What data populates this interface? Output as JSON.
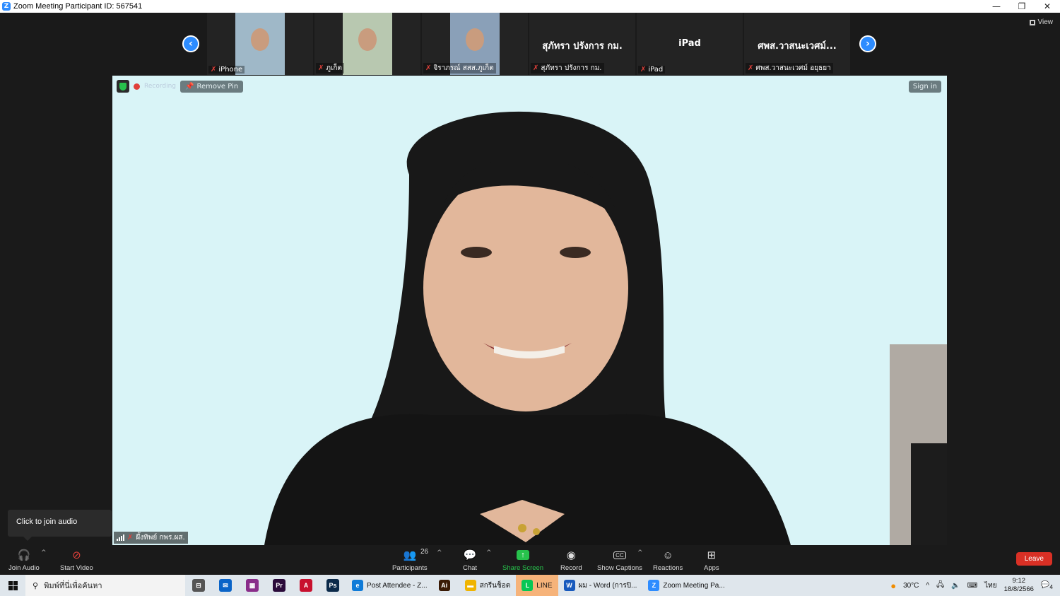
{
  "window": {
    "title": "Zoom Meeting Participant ID: 567541",
    "logo_letter": "Z",
    "minimize": "—",
    "restore": "❐",
    "close": "✕"
  },
  "view_button": "View",
  "strip": {
    "prev": "‹",
    "next": "›",
    "tiles": [
      {
        "name": "iPhone",
        "has_video": true,
        "video_color": "#9fb8c8"
      },
      {
        "name": "ภูเก็ต",
        "has_video": true,
        "video_color": "#b8c8b0"
      },
      {
        "name": "จิราภรณ์ สสส.ภูเก็ต",
        "has_video": true,
        "video_color": "#8aa0b8"
      },
      {
        "name": "สุภัทรา ปรังการ กม.",
        "big_name": "สุภัทรา ปรังการ กม.",
        "has_video": false
      },
      {
        "name": "iPad",
        "big_name": "iPad",
        "has_video": false
      },
      {
        "name": "ศพส.วาสนะเวศม์ อยุธยา",
        "big_name": "ศพส.วาสนะเวศม์...",
        "has_video": false
      }
    ]
  },
  "main_video": {
    "recording_label": "Recording",
    "remove_pin": "Remove Pin",
    "sign_in": "Sign in",
    "participant_name": "ผึ้งทิพย์ กพร.ผส.",
    "bg_color": "#d8f3f7"
  },
  "tooltip": "Click to join audio",
  "toolbar": {
    "join_audio": "Join Audio",
    "start_video": "Start Video",
    "participants": "Participants",
    "participants_count": "26",
    "chat": "Chat",
    "share_screen": "Share Screen",
    "record": "Record",
    "show_captions": "Show Captions",
    "captions_icon": "CC",
    "reactions": "Reactions",
    "apps": "Apps",
    "leave": "Leave"
  },
  "taskbar": {
    "search_placeholder": "พิมพ์ที่นี่เพื่อค้นหา",
    "pinned": [
      {
        "icon": "task-view-icon",
        "label": "⊟",
        "color": "#555"
      },
      {
        "icon": "mail-icon",
        "label": "✉",
        "color": "#0a64c8"
      },
      {
        "icon": "winrar-icon",
        "label": "▦",
        "color": "#8a2d8a"
      },
      {
        "icon": "premiere-icon",
        "label": "Pr",
        "color": "#2a0a3a"
      },
      {
        "icon": "acrobat-icon",
        "label": "A",
        "color": "#c8102e"
      },
      {
        "icon": "photoshop-icon",
        "label": "Ps",
        "color": "#0b2a4a"
      }
    ],
    "apps": [
      {
        "label": "Post Attendee - Z...",
        "icon": "e",
        "color": "#0f7bd8",
        "active": false
      },
      {
        "label": "",
        "icon": "Ai",
        "color": "#3a1a05",
        "active": false
      },
      {
        "label": "สกรีนช็อต",
        "icon": "▬",
        "color": "#f0b400",
        "active": false
      },
      {
        "label": "LINE",
        "icon": "L",
        "color": "#06c755",
        "active": true
      },
      {
        "label": "ผม - Word (การปิ...",
        "icon": "W",
        "color": "#185abd",
        "active": false
      },
      {
        "label": "Zoom Meeting Pa...",
        "icon": "Z",
        "color": "#2d8cff",
        "active": false
      }
    ],
    "weather": "30°C",
    "lang": "ไทย",
    "time": "9:12",
    "date": "18/8/2566",
    "notifications": "4"
  }
}
